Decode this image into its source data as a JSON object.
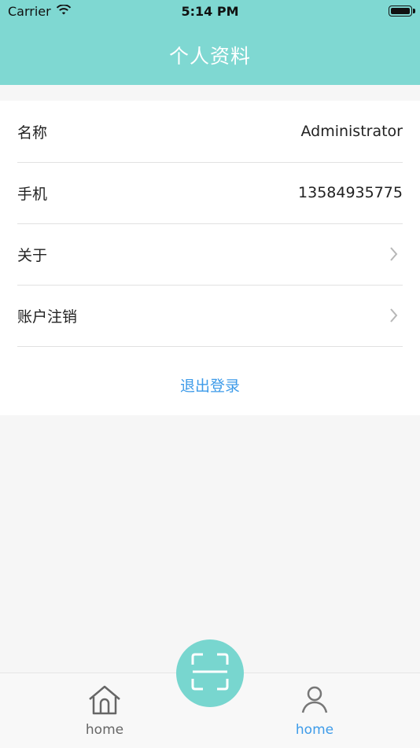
{
  "status_bar": {
    "carrier": "Carrier",
    "time": "5:14 PM"
  },
  "header": {
    "title": "个人资料",
    "background_color": "#7fd8d2"
  },
  "profile": {
    "rows": [
      {
        "label": "名称",
        "value": "Administrator"
      },
      {
        "label": "手机",
        "value": "13584935775"
      },
      {
        "label": "关于",
        "value": ""
      },
      {
        "label": "账户注销",
        "value": ""
      }
    ],
    "logout_label": "退出登录"
  },
  "tabbar": {
    "left_label": "home",
    "right_label": "home",
    "active_color": "#3d9be9",
    "inactive_color": "#666666",
    "scan_button_color": "#78d6cf",
    "icons": {
      "left": "home-icon",
      "center": "scan-icon",
      "right": "user-icon"
    }
  }
}
